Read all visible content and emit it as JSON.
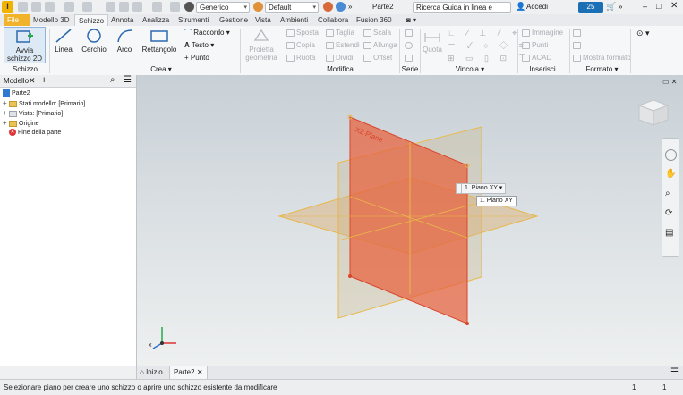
{
  "titlebar": {
    "app_letter": "I",
    "appearance": "Generico",
    "material": "Default",
    "document": "Parte2",
    "search_placeholder": "Ricerca Guida in linea e comand",
    "signin": "Accedi",
    "timer": "25"
  },
  "tabs": [
    "File",
    "Modello 3D",
    "Schizzo",
    "Annota",
    "Analizza",
    "Strumenti",
    "Gestione",
    "Vista",
    "Ambienti",
    "Collabora",
    "Fusion 360"
  ],
  "ribbon": {
    "schizzo": {
      "start_line1": "Avvia",
      "start_line2": "schizzo 2D",
      "label": "Schizzo"
    },
    "crea": {
      "linea": "Linea",
      "cerchio": "Cerchio",
      "arco": "Arco",
      "rettangolo": "Rettangolo",
      "raccordo": "Raccordo",
      "testo": "Testo",
      "punto": "Punto",
      "label": "Crea"
    },
    "proietta": {
      "line1": "Proietta",
      "line2": "geometria"
    },
    "modifica": {
      "sposta": "Sposta",
      "taglia": "Taglia",
      "scala": "Scala",
      "copia": "Copia",
      "estendi": "Estendi",
      "allunga": "Allunga",
      "ruota": "Ruota",
      "dividi": "Dividi",
      "offset": "Offset",
      "label": "Modifica"
    },
    "serie": {
      "label": "Serie"
    },
    "vincola": {
      "quota": "Quota",
      "label": "Vincola"
    },
    "inserisci": {
      "immagine": "Immagine",
      "punti": "Punti",
      "acad": "ACAD",
      "label": "Inserisci"
    },
    "formato": {
      "mostra": "Mostra formato",
      "label": "Formato"
    }
  },
  "browser": {
    "title": "Modello",
    "root": "Parte2",
    "items": [
      "Stati modello: [Primario]",
      "Vista: [Primario]",
      "Origine",
      "Fine della parte"
    ]
  },
  "viewport": {
    "tooltip": "1. Piano XY",
    "menu_item": "1. Piano XY",
    "plane_label": "XZ Plane"
  },
  "doc_tabs": {
    "home": "Inizio",
    "doc": "Parte2"
  },
  "status": {
    "message": "Selezionare piano per creare uno schizzo o aprire uno schizzo esistente da modificare",
    "count1": "1",
    "count2": "1"
  },
  "colors": {
    "accent": "#1a6fb5",
    "file_tab": "#f1b32b",
    "selected_plane": "#e8613c",
    "plane_edge": "#e9b84a"
  }
}
